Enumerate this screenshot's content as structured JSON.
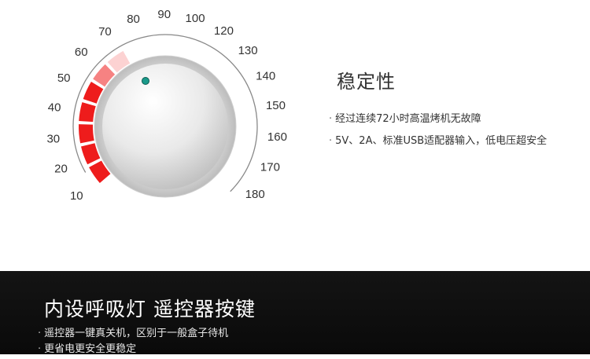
{
  "dial": {
    "scale_labels": [
      "10",
      "20",
      "30",
      "40",
      "50",
      "60",
      "70",
      "80",
      "90",
      "100",
      "120",
      "130",
      "140",
      "150",
      "160",
      "170",
      "180"
    ],
    "accent_red": "#ee1c1c",
    "knob_indicator_color": "#1a9a8a"
  },
  "feature": {
    "title": "稳定性",
    "items": [
      "经过连续72小时高温烤机无故障",
      "5V、2A、标准USB适配器输入，低电压超安全"
    ]
  },
  "bottom": {
    "title": "内设呼吸灯 遥控器按键",
    "items": [
      "遥控器一键真关机，区别于一般盒子待机",
      "更省电更安全更稳定"
    ]
  }
}
